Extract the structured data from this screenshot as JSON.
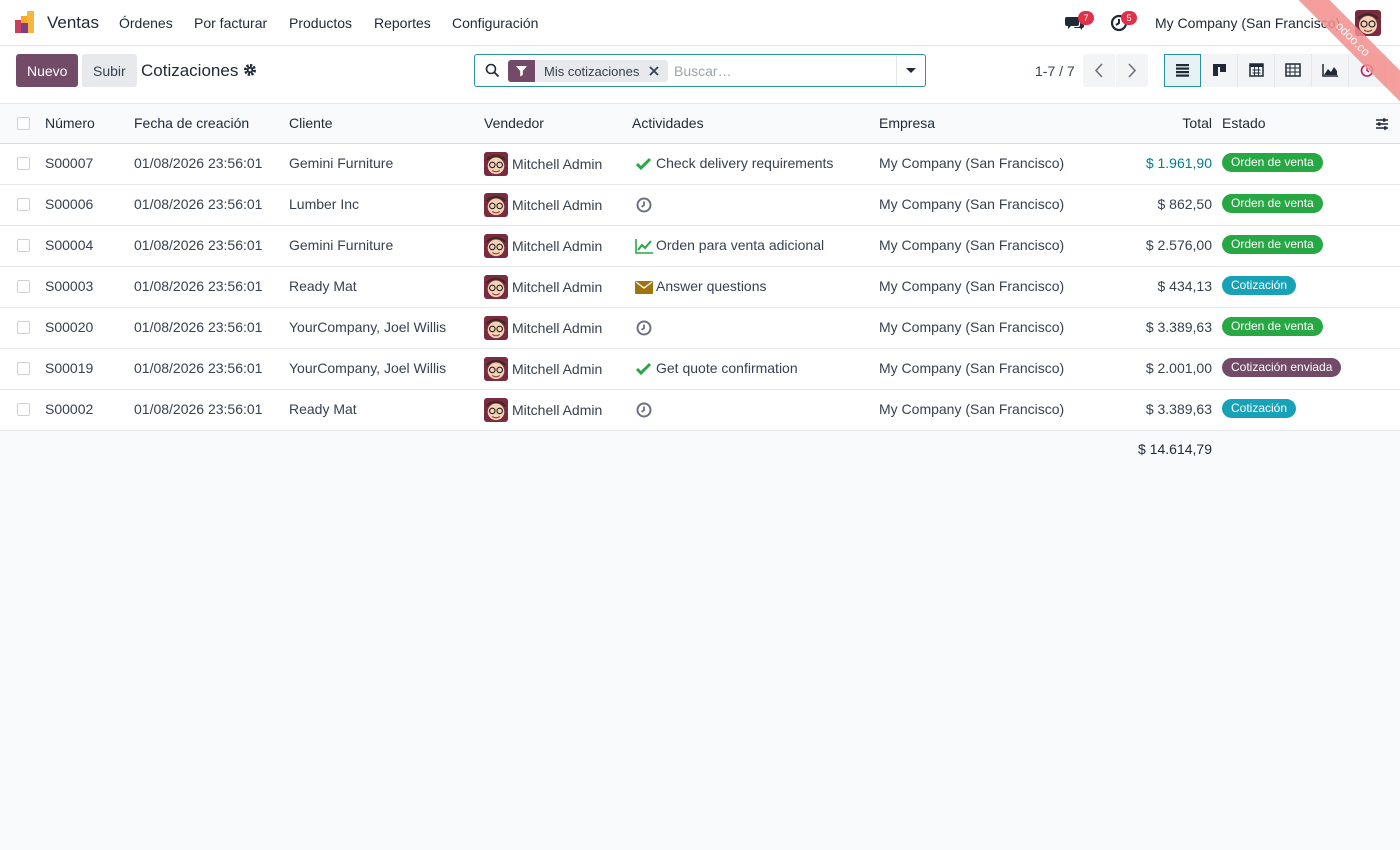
{
  "app": {
    "name": "Ventas"
  },
  "menu": [
    "Órdenes",
    "Por facturar",
    "Productos",
    "Reportes",
    "Configuración"
  ],
  "systray": {
    "messages_count": "7",
    "activities_count": "5",
    "company": "My Company (San Francisco)",
    "ribbon": "odoo.co"
  },
  "control_panel": {
    "new_label": "Nuevo",
    "upload_label": "Subir",
    "title": "Cotizaciones",
    "facet_label": "Mis cotizaciones",
    "search_placeholder": "Buscar…",
    "pager": "1-7 / 7"
  },
  "table": {
    "headers": {
      "number": "Número",
      "date": "Fecha de creación",
      "customer": "Cliente",
      "salesperson": "Vendedor",
      "activities": "Actividades",
      "company": "Empresa",
      "total": "Total",
      "state": "Estado"
    },
    "rows": [
      {
        "number": "S00007",
        "date": "01/08/2026 23:56:01",
        "customer": "Gemini Furniture",
        "salesperson": "Mitchell Admin",
        "activity_icon": "check-icon",
        "activity": "Check delivery requirements",
        "company": "My Company (San Francisco)",
        "total": "$ 1.961,90",
        "state": "Orden de venta",
        "state_kind": "green",
        "total_highlight": true
      },
      {
        "number": "S00006",
        "date": "01/08/2026 23:56:01",
        "customer": "Lumber Inc",
        "salesperson": "Mitchell Admin",
        "activity_icon": "clock-icon",
        "activity": "",
        "company": "My Company (San Francisco)",
        "total": "$ 862,50",
        "state": "Orden de venta",
        "state_kind": "green",
        "total_highlight": false
      },
      {
        "number": "S00004",
        "date": "01/08/2026 23:56:01",
        "customer": "Gemini Furniture",
        "salesperson": "Mitchell Admin",
        "activity_icon": "upsell-chart-icon",
        "activity": "Orden para venta adicional",
        "company": "My Company (San Francisco)",
        "total": "$ 2.576,00",
        "state": "Orden de venta",
        "state_kind": "green",
        "total_highlight": false
      },
      {
        "number": "S00003",
        "date": "01/08/2026 23:56:01",
        "customer": "Ready Mat",
        "salesperson": "Mitchell Admin",
        "activity_icon": "envelope-icon",
        "activity": "Answer questions",
        "company": "My Company (San Francisco)",
        "total": "$ 434,13",
        "state": "Cotización",
        "state_kind": "cyan",
        "total_highlight": false
      },
      {
        "number": "S00020",
        "date": "01/08/2026 23:56:01",
        "customer": "YourCompany, Joel Willis",
        "salesperson": "Mitchell Admin",
        "activity_icon": "clock-icon",
        "activity": "",
        "company": "My Company (San Francisco)",
        "total": "$ 3.389,63",
        "state": "Orden de venta",
        "state_kind": "green",
        "total_highlight": false
      },
      {
        "number": "S00019",
        "date": "01/08/2026 23:56:01",
        "customer": "YourCompany, Joel Willis",
        "salesperson": "Mitchell Admin",
        "activity_icon": "check-icon",
        "activity": "Get quote confirmation",
        "company": "My Company (San Francisco)",
        "total": "$ 2.001,00",
        "state": "Cotización enviada",
        "state_kind": "purple",
        "total_highlight": false
      },
      {
        "number": "S00002",
        "date": "01/08/2026 23:56:01",
        "customer": "Ready Mat",
        "salesperson": "Mitchell Admin",
        "activity_icon": "clock-icon",
        "activity": "",
        "company": "My Company (San Francisco)",
        "total": "$ 3.389,63",
        "state": "Cotización",
        "state_kind": "cyan",
        "total_highlight": false
      }
    ],
    "sum_total": "$ 14.614,79"
  },
  "colors": {
    "brand": "#714b67",
    "accent": "#2a8fa0",
    "link_total": "#017e84",
    "success": "#28a745",
    "info": "#17a2b8"
  }
}
